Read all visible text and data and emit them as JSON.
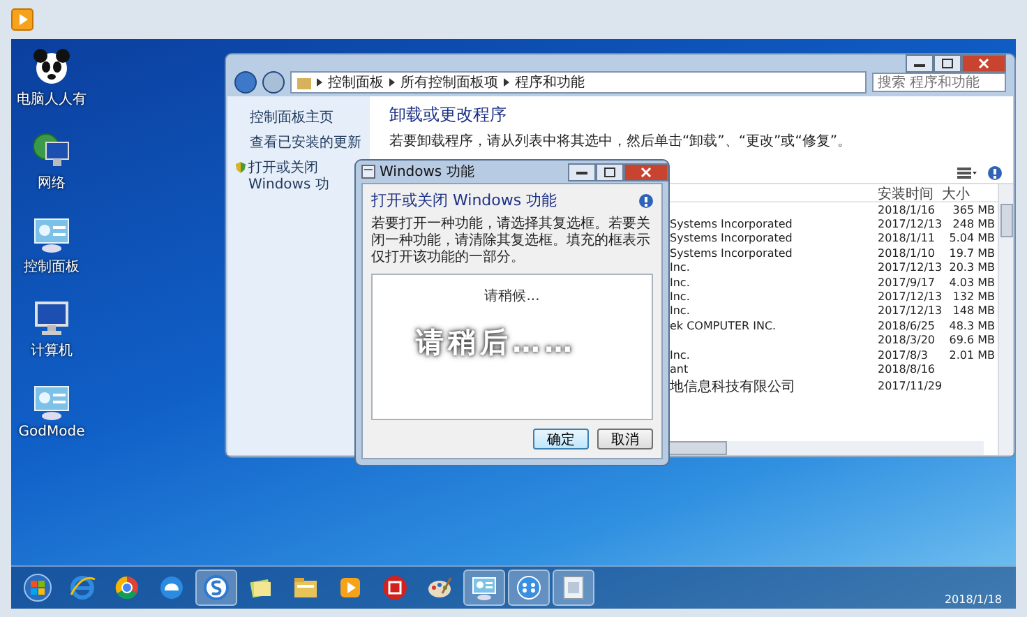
{
  "desktop_icons": [
    {
      "label": "电脑人人有",
      "kind": "panda"
    },
    {
      "label": "网络",
      "kind": "network"
    },
    {
      "label": "控制面板",
      "kind": "panel"
    },
    {
      "label": "计算机",
      "kind": "computer"
    },
    {
      "label": "GodMode",
      "kind": "panel"
    }
  ],
  "explorer": {
    "breadcrumb": [
      "控制面板",
      "所有控制面板项",
      "程序和功能"
    ],
    "search": {
      "placeholder": "搜索 程序和功能"
    },
    "sidebar": {
      "items": [
        {
          "label": "控制面板主页",
          "kind": "link"
        },
        {
          "label": "查看已安装的更新",
          "kind": "link"
        },
        {
          "label": "打开或关闭 Windows 功",
          "kind": "shield"
        }
      ]
    },
    "heading": "卸载或更改程序",
    "description": "若要卸载程序，请从列表中将其选中，然后单击“卸载”、“更改”或“修复”。",
    "table": {
      "columns": [
        "安装时间",
        "大小"
      ],
      "rows": [
        {
          "installed_on": "2018/1/16",
          "size": "365 MB"
        },
        {
          "column_1": "Systems Incorporated",
          "installed_on": "2017/12/13",
          "size": "248 MB"
        },
        {
          "column_1": "Systems Incorporated",
          "installed_on": "2018/1/11",
          "size": "5.04 MB"
        },
        {
          "column_1": "Systems Incorporated",
          "installed_on": "2018/1/10",
          "size": "19.7 MB"
        },
        {
          "column_1": "Inc.",
          "installed_on": "2017/12/13",
          "size": "20.3 MB"
        },
        {
          "column_1": "Inc.",
          "installed_on": "2017/9/17",
          "size": "4.03 MB"
        },
        {
          "column_1": "Inc.",
          "installed_on": "2017/12/13",
          "size": "132 MB"
        },
        {
          "column_1": "Inc.",
          "installed_on": "2017/12/13",
          "size": "148 MB"
        },
        {
          "column_1": "ek COMPUTER INC.",
          "installed_on": "2018/6/25",
          "size": "48.3 MB"
        },
        {
          "installed_on": "2018/3/20",
          "size": "69.6 MB"
        },
        {
          "column_1": "Inc.",
          "installed_on": "2017/8/3",
          "size": "2.01 MB"
        },
        {
          "column_1": "ant",
          "installed_on": "2018/8/16"
        },
        {
          "column_1": "地信息科技有限公司",
          "installed_on": "2017/11/29"
        }
      ]
    }
  },
  "dialog": {
    "title": "Windows 功能",
    "heading": "打开或关闭 Windows 功能",
    "description": "若要打开一种功能，请选择其复选框。若要关闭一种功能，请清除其复选框。填充的框表示仅打开该功能的一部分。",
    "status": "请稍候...",
    "buttons": [
      {
        "label": "确定",
        "default": true
      },
      {
        "label": "取消",
        "default": false
      }
    ]
  },
  "caption": "请稍后……",
  "taskbar": {
    "items": [
      {
        "kind": "start",
        "open": false
      },
      {
        "kind": "ie",
        "open": false
      },
      {
        "kind": "chrome",
        "open": false
      },
      {
        "kind": "cloud",
        "open": false
      },
      {
        "kind": "s",
        "open": true
      },
      {
        "kind": "folder-yellow",
        "open": false
      },
      {
        "kind": "folder",
        "open": false
      },
      {
        "kind": "media",
        "open": false
      },
      {
        "kind": "red-seal",
        "open": false
      },
      {
        "kind": "palette",
        "open": false
      },
      {
        "kind": "panel",
        "open": true
      },
      {
        "kind": "dots",
        "open": true
      },
      {
        "kind": "feature",
        "open": true
      }
    ],
    "date": "2018/1/18"
  }
}
